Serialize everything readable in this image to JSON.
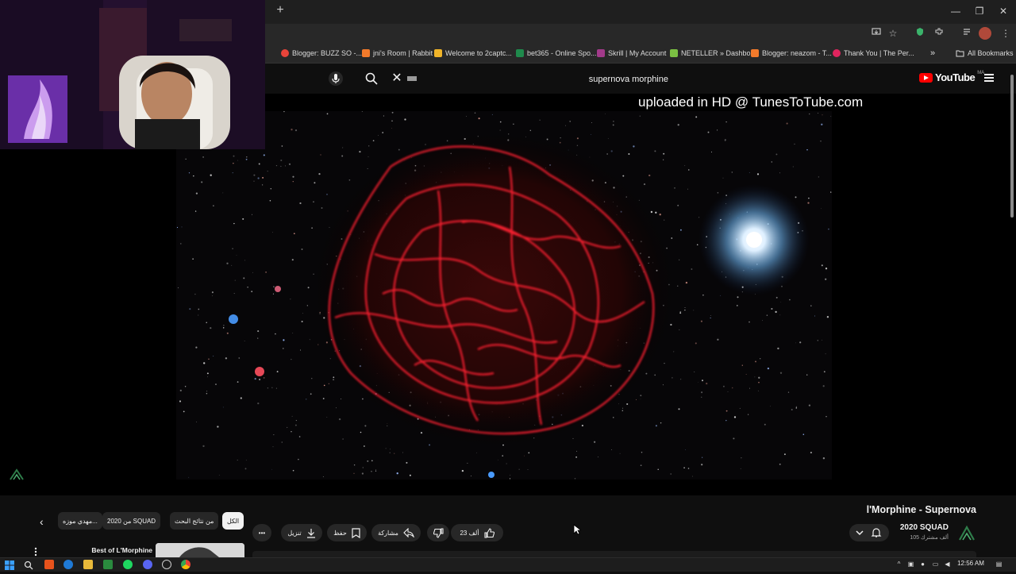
{
  "browser": {
    "new_tab_symbol": "+",
    "window_controls": [
      "—",
      "❐",
      "✕"
    ],
    "bookmarks": [
      {
        "label": "Blogger: BUZZ SO -...",
        "color": "#e8443a"
      },
      {
        "label": "jni's Room | Rabbit",
        "color": "#f27a2b"
      },
      {
        "label": "Welcome to 2captc...",
        "color": "#f0b429"
      },
      {
        "label": "bet365 - Online Spo...",
        "color": "#1f8a4c"
      },
      {
        "label": "Skrill | My Account",
        "color": "#a23a8a"
      },
      {
        "label": "NETELLER » Dashbo...",
        "color": "#7bc043"
      },
      {
        "label": "Blogger: neazom - T...",
        "color": "#f27a2b"
      },
      {
        "label": "Thank You | The Per...",
        "color": "#e0245e"
      }
    ],
    "bookmarks_overflow": "»",
    "all_bookmarks": "All Bookmarks"
  },
  "youtube": {
    "search_query": "supernova morphine",
    "logo_text": "YouTube",
    "logo_region": "MA",
    "video": {
      "watermark": "uploaded in HD @ TunesToTube.com",
      "title": "l'Morphine - Supernova"
    },
    "channel": {
      "name": "2020 SQUAD",
      "subscribers": "105 ألف مشترك"
    },
    "actions": {
      "likes": "23 ألف",
      "share": "مشاركة",
      "save": "حفظ",
      "download": "تنزيل",
      "more": "•••"
    },
    "chips": [
      "الكل",
      "من نتائج البحث",
      "من 2020 SQUAD",
      "مهدي موزه..."
    ],
    "recommendation": {
      "title": "Best of L'Morphine"
    }
  },
  "taskbar": {
    "time": "12:56 AM"
  },
  "colors": {
    "yt_red": "#ff0000",
    "bg": "#0f0f0f",
    "pill": "#272727"
  }
}
